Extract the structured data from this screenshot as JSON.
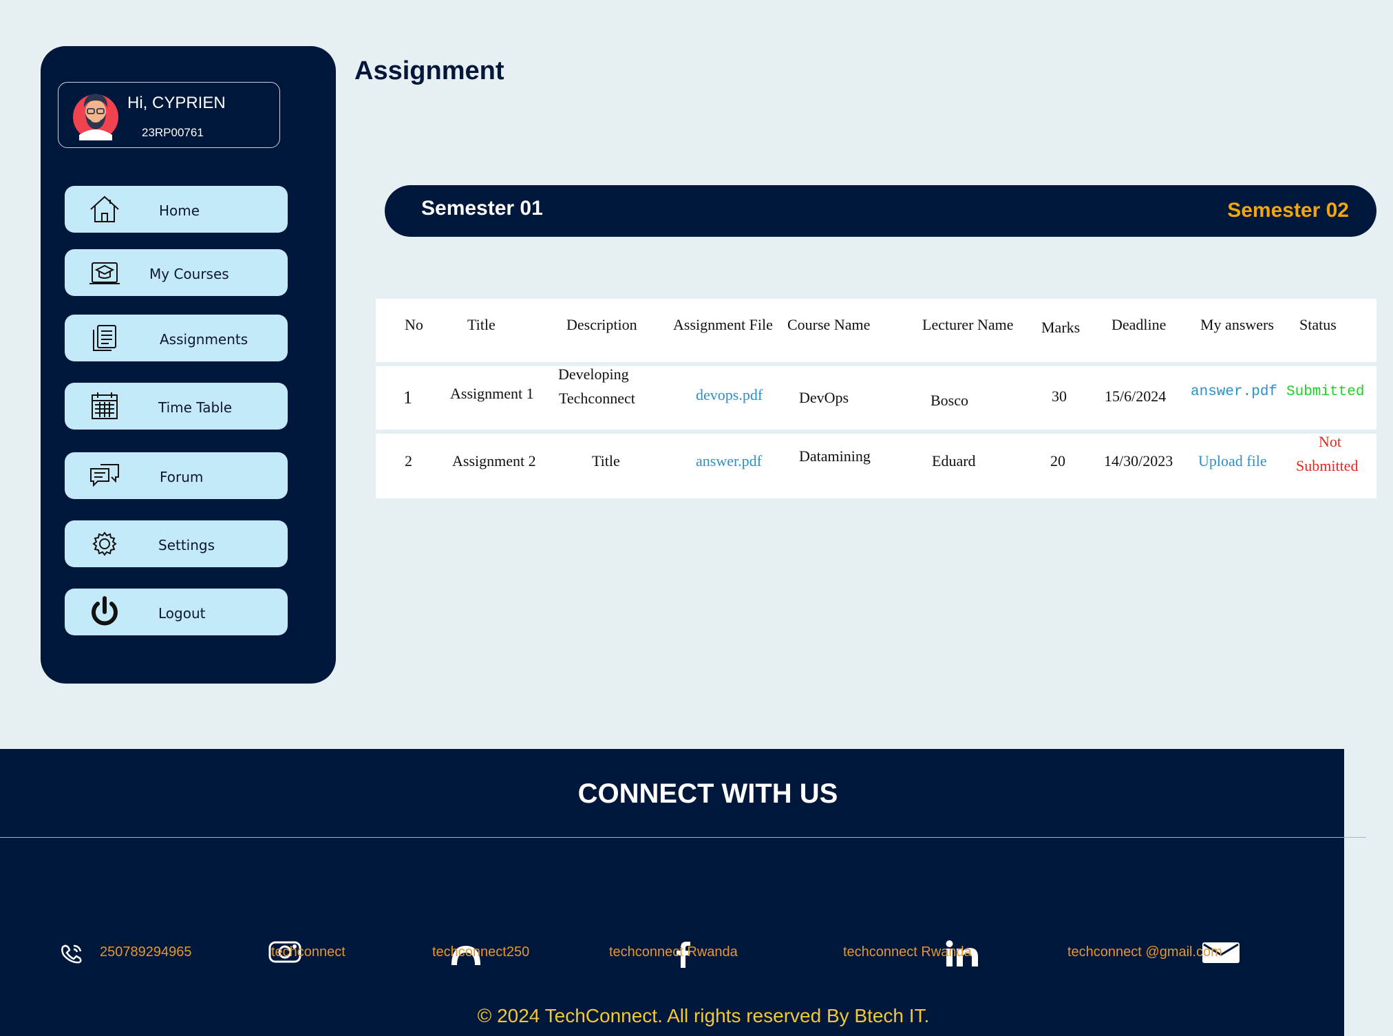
{
  "page": {
    "title": "Assignment"
  },
  "sidebar": {
    "greeting": "Hi, CYPRIEN",
    "reg_number": "23RP00761",
    "items": [
      {
        "label": "Home",
        "icon": "home-icon"
      },
      {
        "label": "My Courses",
        "icon": "courses-icon"
      },
      {
        "label": "Assignments",
        "icon": "assignments-icon"
      },
      {
        "label": "Time Table",
        "icon": "calendar-icon"
      },
      {
        "label": "Forum",
        "icon": "chat-icon"
      },
      {
        "label": "Settings",
        "icon": "gear-icon"
      },
      {
        "label": "Logout",
        "icon": "power-icon"
      }
    ]
  },
  "semesters": {
    "first": "Semester 01",
    "second": "Semester 02",
    "second_color": "#f2a60c"
  },
  "table": {
    "headers": [
      "No",
      "Title",
      "Description",
      "Assignment File",
      "Course Name",
      "Lecturer Name",
      "Marks",
      "Deadline",
      "My answers",
      "Status"
    ],
    "rows": [
      {
        "no": "1",
        "title": "Assignment 1",
        "description_1": "Developing",
        "description_2": "Techconnect",
        "file": "devops.pdf",
        "course": "DevOps",
        "lecturer": "Bosco",
        "marks": "30",
        "deadline": "15/6/2024",
        "answer": "answer.pdf",
        "status": "Submitted"
      },
      {
        "no": "2",
        "title": "Assignment 2",
        "description_1": "Title",
        "file": "answer.pdf",
        "course": "Datamining",
        "lecturer": "Eduard",
        "marks": "20",
        "deadline": "14/30/2023",
        "answer": "Upload file",
        "status_1": "Not",
        "status_2": "Submitted"
      }
    ],
    "colors": {
      "link": "#2f8fc5",
      "submitted": "#21d121",
      "not_submitted": "#e22a1a"
    }
  },
  "footer": {
    "title": "CONNECT WITH US",
    "contacts": [
      {
        "icon": "phone-icon",
        "text": "250789294965"
      },
      {
        "icon": "instagram-icon",
        "text": "techconnect"
      },
      {
        "icon": "github-icon",
        "text": "techconnect250"
      },
      {
        "icon": "facebook-icon",
        "text": "techconnect Rwanda"
      },
      {
        "icon": "linkedin-icon",
        "text": "techconnect Rwanda"
      },
      {
        "icon": "email-icon",
        "text": "techconnect @gmail.com"
      }
    ],
    "copyright": "© 2024 TechConnect. All rights reserved By Btech IT."
  },
  "colors": {
    "navy": "#00173c",
    "background": "#e6eff1",
    "nav_button": "#c4e9f8",
    "footer_text": "#e3992c",
    "copyright": "#f2c92e"
  }
}
